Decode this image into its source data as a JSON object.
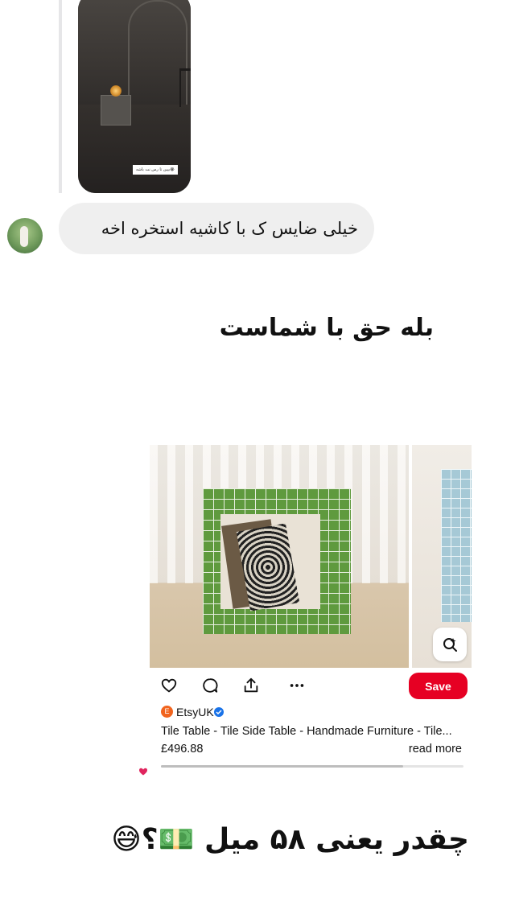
{
  "story": {
    "sticker_text": "بپین تا رس نت باشه😭"
  },
  "comment": {
    "avatar": "avatar-image",
    "text": "خیلی ضایس ک با کاشیه استخره اخه"
  },
  "headline_1": "بله حق با شماست",
  "pin": {
    "brand_logo_letter": "E",
    "brand_name": "EtsyUK",
    "title": "Tile Table - Tile Side Table - Handmade Furniture - Tile...",
    "price": "£496.88",
    "read_more": "read more",
    "save_label": "Save",
    "icons": [
      "heart-icon",
      "comment-icon",
      "share-icon",
      "more-icon",
      "visual-search-icon",
      "verified-badge-icon"
    ],
    "accent_color": "#e60023",
    "carousel_progress": 0.8
  },
  "reaction_icon": "heart-icon",
  "headline_2": "چقدر یعنی ۵۸ میل 💵؟😅"
}
